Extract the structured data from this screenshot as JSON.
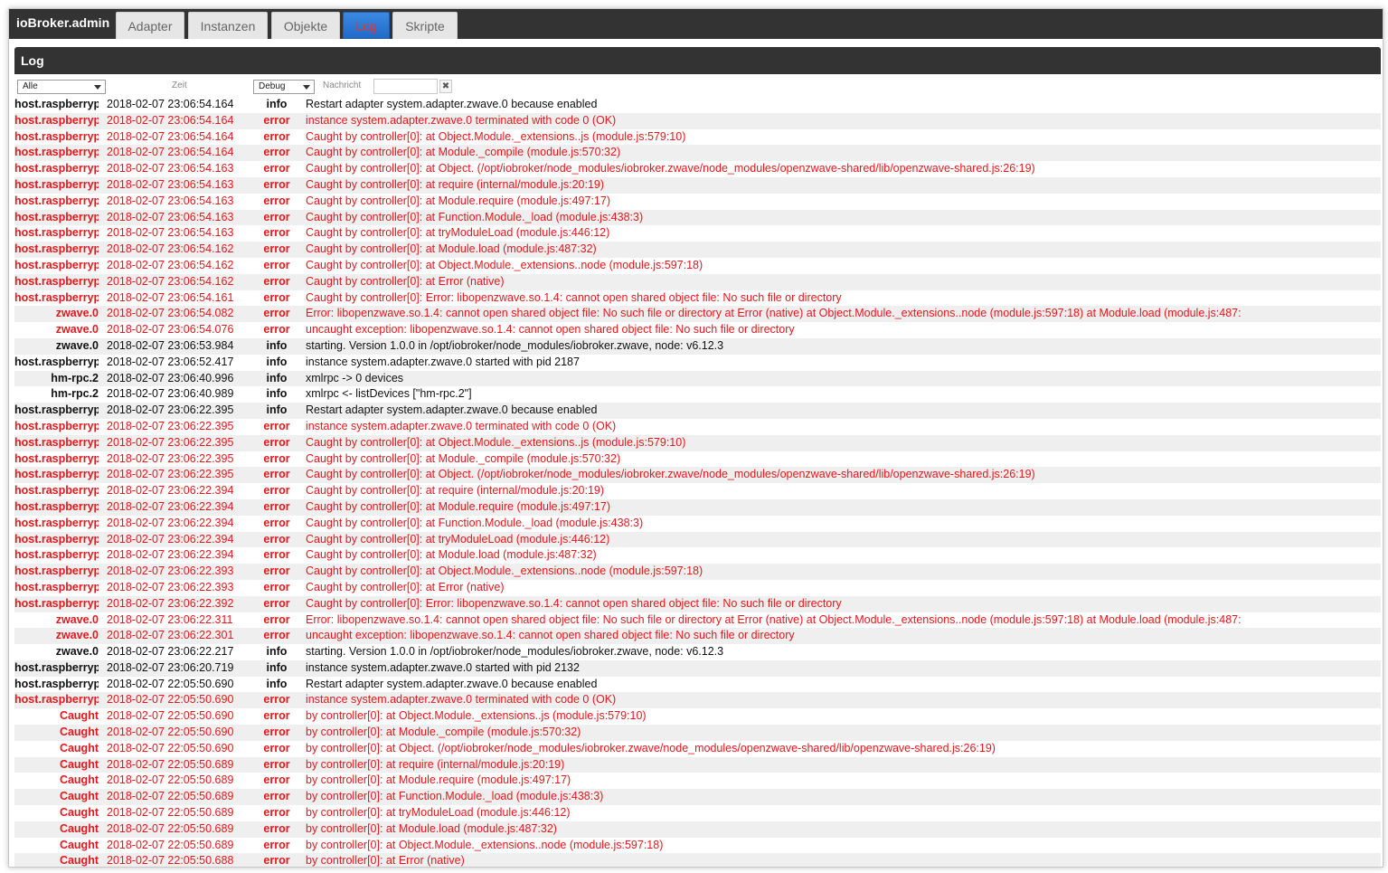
{
  "app": {
    "title": "ioBroker.admin",
    "tabs": [
      "Adapter",
      "Instanzen",
      "Objekte",
      "Log",
      "Skripte"
    ],
    "active_tab": "Log"
  },
  "panel": {
    "title": "Log"
  },
  "filters": {
    "source_value": "Alle",
    "time_label": "Zeit",
    "level_value": "Debug",
    "message_label": "Nachricht",
    "message_value": "",
    "clear_symbol": "✖"
  },
  "colors": {
    "error": "#e8161b",
    "active_tab": "#2f7ed8",
    "header": "#333333"
  },
  "log": [
    {
      "src": "host.raspberrypi",
      "time": "2018-02-07 23:06:54.164",
      "sev": "info",
      "msg": "Restart adapter system.adapter.zwave.0 because enabled"
    },
    {
      "src": "host.raspberrypi",
      "time": "2018-02-07 23:06:54.164",
      "sev": "error",
      "msg": "instance system.adapter.zwave.0 terminated with code 0 (OK)"
    },
    {
      "src": "host.raspberrypi",
      "time": "2018-02-07 23:06:54.164",
      "sev": "error",
      "msg": "Caught by controller[0]: at Object.Module._extensions..js (module.js:579:10)"
    },
    {
      "src": "host.raspberrypi",
      "time": "2018-02-07 23:06:54.164",
      "sev": "error",
      "msg": "Caught by controller[0]: at Module._compile (module.js:570:32)"
    },
    {
      "src": "host.raspberrypi",
      "time": "2018-02-07 23:06:54.163",
      "sev": "error",
      "msg": "Caught by controller[0]: at Object. (/opt/iobroker/node_modules/iobroker.zwave/node_modules/openzwave-shared/lib/openzwave-shared.js:26:19)"
    },
    {
      "src": "host.raspberrypi",
      "time": "2018-02-07 23:06:54.163",
      "sev": "error",
      "msg": "Caught by controller[0]: at require (internal/module.js:20:19)"
    },
    {
      "src": "host.raspberrypi",
      "time": "2018-02-07 23:06:54.163",
      "sev": "error",
      "msg": "Caught by controller[0]: at Module.require (module.js:497:17)"
    },
    {
      "src": "host.raspberrypi",
      "time": "2018-02-07 23:06:54.163",
      "sev": "error",
      "msg": "Caught by controller[0]: at Function.Module._load (module.js:438:3)"
    },
    {
      "src": "host.raspberrypi",
      "time": "2018-02-07 23:06:54.163",
      "sev": "error",
      "msg": "Caught by controller[0]: at tryModuleLoad (module.js:446:12)"
    },
    {
      "src": "host.raspberrypi",
      "time": "2018-02-07 23:06:54.162",
      "sev": "error",
      "msg": "Caught by controller[0]: at Module.load (module.js:487:32)"
    },
    {
      "src": "host.raspberrypi",
      "time": "2018-02-07 23:06:54.162",
      "sev": "error",
      "msg": "Caught by controller[0]: at Object.Module._extensions..node (module.js:597:18)"
    },
    {
      "src": "host.raspberrypi",
      "time": "2018-02-07 23:06:54.162",
      "sev": "error",
      "msg": "Caught by controller[0]: at Error (native)"
    },
    {
      "src": "host.raspberrypi",
      "time": "2018-02-07 23:06:54.161",
      "sev": "error",
      "msg": "Caught by controller[0]: Error: libopenzwave.so.1.4: cannot open shared object file: No such file or directory"
    },
    {
      "src": "zwave.0",
      "time": "2018-02-07 23:06:54.082",
      "sev": "error",
      "msg": "Error: libopenzwave.so.1.4: cannot open shared object file: No such file or directory at Error (native) at Object.Module._extensions..node (module.js:597:18) at Module.load (module.js:487:"
    },
    {
      "src": "zwave.0",
      "time": "2018-02-07 23:06:54.076",
      "sev": "error",
      "msg": "uncaught exception: libopenzwave.so.1.4: cannot open shared object file: No such file or directory"
    },
    {
      "src": "zwave.0",
      "time": "2018-02-07 23:06:53.984",
      "sev": "info",
      "msg": "starting. Version 1.0.0 in /opt/iobroker/node_modules/iobroker.zwave, node: v6.12.3"
    },
    {
      "src": "host.raspberrypi",
      "time": "2018-02-07 23:06:52.417",
      "sev": "info",
      "msg": "instance system.adapter.zwave.0 started with pid 2187"
    },
    {
      "src": "hm-rpc.2",
      "time": "2018-02-07 23:06:40.996",
      "sev": "info",
      "msg": "xmlrpc -> 0 devices"
    },
    {
      "src": "hm-rpc.2",
      "time": "2018-02-07 23:06:40.989",
      "sev": "info",
      "msg": "xmlrpc <- listDevices [\"hm-rpc.2\"]"
    },
    {
      "src": "host.raspberrypi",
      "time": "2018-02-07 23:06:22.395",
      "sev": "info",
      "msg": "Restart adapter system.adapter.zwave.0 because enabled"
    },
    {
      "src": "host.raspberrypi",
      "time": "2018-02-07 23:06:22.395",
      "sev": "error",
      "msg": "instance system.adapter.zwave.0 terminated with code 0 (OK)"
    },
    {
      "src": "host.raspberrypi",
      "time": "2018-02-07 23:06:22.395",
      "sev": "error",
      "msg": "Caught by controller[0]: at Object.Module._extensions..js (module.js:579:10)"
    },
    {
      "src": "host.raspberrypi",
      "time": "2018-02-07 23:06:22.395",
      "sev": "error",
      "msg": "Caught by controller[0]: at Module._compile (module.js:570:32)"
    },
    {
      "src": "host.raspberrypi",
      "time": "2018-02-07 23:06:22.395",
      "sev": "error",
      "msg": "Caught by controller[0]: at Object. (/opt/iobroker/node_modules/iobroker.zwave/node_modules/openzwave-shared/lib/openzwave-shared.js:26:19)"
    },
    {
      "src": "host.raspberrypi",
      "time": "2018-02-07 23:06:22.394",
      "sev": "error",
      "msg": "Caught by controller[0]: at require (internal/module.js:20:19)"
    },
    {
      "src": "host.raspberrypi",
      "time": "2018-02-07 23:06:22.394",
      "sev": "error",
      "msg": "Caught by controller[0]: at Module.require (module.js:497:17)"
    },
    {
      "src": "host.raspberrypi",
      "time": "2018-02-07 23:06:22.394",
      "sev": "error",
      "msg": "Caught by controller[0]: at Function.Module._load (module.js:438:3)"
    },
    {
      "src": "host.raspberrypi",
      "time": "2018-02-07 23:06:22.394",
      "sev": "error",
      "msg": "Caught by controller[0]: at tryModuleLoad (module.js:446:12)"
    },
    {
      "src": "host.raspberrypi",
      "time": "2018-02-07 23:06:22.394",
      "sev": "error",
      "msg": "Caught by controller[0]: at Module.load (module.js:487:32)"
    },
    {
      "src": "host.raspberrypi",
      "time": "2018-02-07 23:06:22.393",
      "sev": "error",
      "msg": "Caught by controller[0]: at Object.Module._extensions..node (module.js:597:18)"
    },
    {
      "src": "host.raspberrypi",
      "time": "2018-02-07 23:06:22.393",
      "sev": "error",
      "msg": "Caught by controller[0]: at Error (native)"
    },
    {
      "src": "host.raspberrypi",
      "time": "2018-02-07 23:06:22.392",
      "sev": "error",
      "msg": "Caught by controller[0]: Error: libopenzwave.so.1.4: cannot open shared object file: No such file or directory"
    },
    {
      "src": "zwave.0",
      "time": "2018-02-07 23:06:22.311",
      "sev": "error",
      "msg": "Error: libopenzwave.so.1.4: cannot open shared object file: No such file or directory at Error (native) at Object.Module._extensions..node (module.js:597:18) at Module.load (module.js:487:"
    },
    {
      "src": "zwave.0",
      "time": "2018-02-07 23:06:22.301",
      "sev": "error",
      "msg": "uncaught exception: libopenzwave.so.1.4: cannot open shared object file: No such file or directory"
    },
    {
      "src": "zwave.0",
      "time": "2018-02-07 23:06:22.217",
      "sev": "info",
      "msg": "starting. Version 1.0.0 in /opt/iobroker/node_modules/iobroker.zwave, node: v6.12.3"
    },
    {
      "src": "host.raspberrypi",
      "time": "2018-02-07 23:06:20.719",
      "sev": "info",
      "msg": "instance system.adapter.zwave.0 started with pid 2132"
    },
    {
      "src": "host.raspberrypi",
      "time": "2018-02-07 22:05:50.690",
      "sev": "info",
      "msg": "Restart adapter system.adapter.zwave.0 because enabled"
    },
    {
      "src": "host.raspberrypi",
      "time": "2018-02-07 22:05:50.690",
      "sev": "error",
      "msg": "instance system.adapter.zwave.0 terminated with code 0 (OK)"
    },
    {
      "src": "Caught",
      "time": "2018-02-07 22:05:50.690",
      "sev": "error",
      "msg": "by controller[0]: at Object.Module._extensions..js (module.js:579:10)"
    },
    {
      "src": "Caught",
      "time": "2018-02-07 22:05:50.690",
      "sev": "error",
      "msg": "by controller[0]: at Module._compile (module.js:570:32)"
    },
    {
      "src": "Caught",
      "time": "2018-02-07 22:05:50.690",
      "sev": "error",
      "msg": "by controller[0]: at Object. (/opt/iobroker/node_modules/iobroker.zwave/node_modules/openzwave-shared/lib/openzwave-shared.js:26:19)"
    },
    {
      "src": "Caught",
      "time": "2018-02-07 22:05:50.689",
      "sev": "error",
      "msg": "by controller[0]: at require (internal/module.js:20:19)"
    },
    {
      "src": "Caught",
      "time": "2018-02-07 22:05:50.689",
      "sev": "error",
      "msg": "by controller[0]: at Module.require (module.js:497:17)"
    },
    {
      "src": "Caught",
      "time": "2018-02-07 22:05:50.689",
      "sev": "error",
      "msg": "by controller[0]: at Function.Module._load (module.js:438:3)"
    },
    {
      "src": "Caught",
      "time": "2018-02-07 22:05:50.689",
      "sev": "error",
      "msg": "by controller[0]: at tryModuleLoad (module.js:446:12)"
    },
    {
      "src": "Caught",
      "time": "2018-02-07 22:05:50.689",
      "sev": "error",
      "msg": "by controller[0]: at Module.load (module.js:487:32)"
    },
    {
      "src": "Caught",
      "time": "2018-02-07 22:05:50.689",
      "sev": "error",
      "msg": "by controller[0]: at Object.Module._extensions..node (module.js:597:18)"
    },
    {
      "src": "Caught",
      "time": "2018-02-07 22:05:50.688",
      "sev": "error",
      "msg": "by controller[0]: at Error (native)"
    }
  ]
}
